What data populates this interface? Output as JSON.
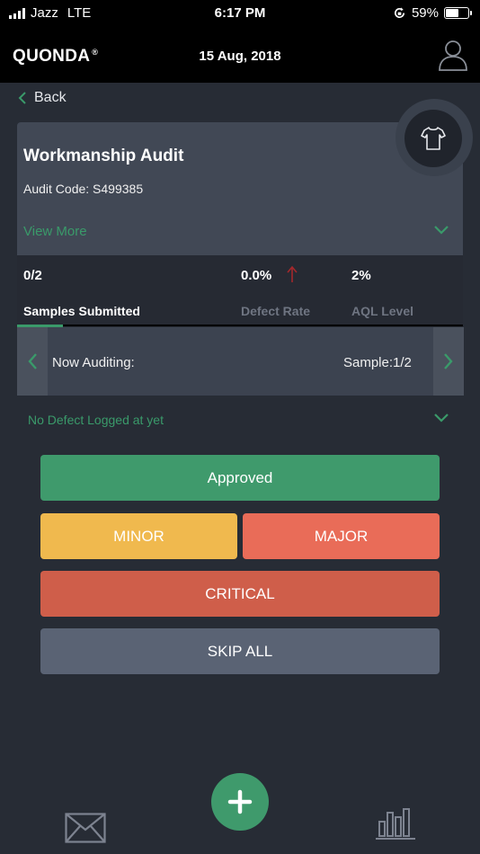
{
  "status_bar": {
    "carrier": "Jazz",
    "network": "LTE",
    "time": "6:17 PM",
    "battery_percent": "59%",
    "battery_level": 0.59
  },
  "header": {
    "brand": "QUONDA",
    "brand_mark": "®",
    "date": "15 Aug, 2018"
  },
  "nav": {
    "back_label": "Back"
  },
  "audit": {
    "title": "Workmanship Audit",
    "code": "Audit Code: S499385",
    "view_more": "View More"
  },
  "stats": {
    "samples_value": "0/2",
    "samples_label": "Samples Submitted",
    "defect_rate_value": "0.0%",
    "defect_rate_label": "Defect Rate",
    "aql_value": "2%",
    "aql_label": "AQL Level"
  },
  "auditing": {
    "label": "Now Auditing:",
    "sample": "Sample:1/2"
  },
  "defects": {
    "message": "No Defect Logged at yet"
  },
  "buttons": {
    "approved": "Approved",
    "minor": "MINOR",
    "major": "MAJOR",
    "critical": "CRITICAL",
    "skip_all": "SKIP ALL"
  },
  "icons": {
    "back": "chevron-left-icon",
    "profile": "user-icon",
    "product": "shirt-icon",
    "defect_trend": "arrow-up-icon",
    "add": "plus-icon",
    "messages": "mail-icon",
    "reports": "bar-chart-icon"
  },
  "colors": {
    "accent_green": "#3f9a6c",
    "minor_yellow": "#f0b94e",
    "major_orange": "#e96c58",
    "critical_red": "#cf5e4a",
    "skip_gray": "#5a6374",
    "trend_red": "#a3282c"
  }
}
